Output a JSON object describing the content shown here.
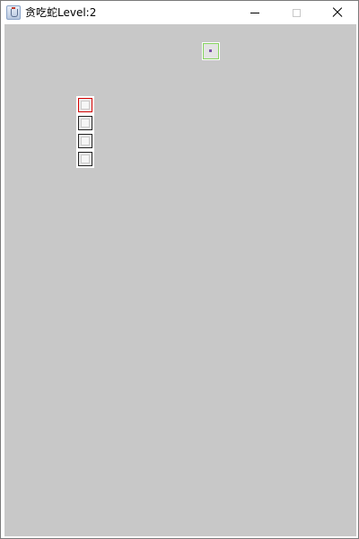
{
  "window": {
    "title": "贪吃蛇Level:2",
    "icon": "java-cup-icon",
    "controls": [
      "minimize-icon",
      "maximize-icon",
      "close-icon"
    ]
  },
  "game": {
    "columns": 20,
    "rows": 29,
    "level": 2,
    "food": {
      "col": 11,
      "row": 1
    },
    "snake": [
      {
        "col": 4,
        "row": 4
      },
      {
        "col": 4,
        "row": 5
      },
      {
        "col": 4,
        "row": 6
      },
      {
        "col": 4,
        "row": 7
      }
    ],
    "colors": {
      "snake_head": "#d40000",
      "snake_body": "#222222",
      "food": "#86d35f",
      "board": "#bdbdbd"
    }
  }
}
